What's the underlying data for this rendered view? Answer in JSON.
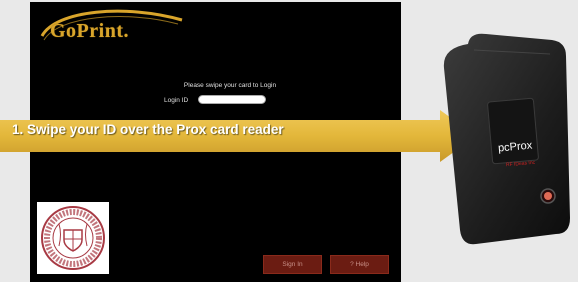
{
  "logo": {
    "text": "GoPrint."
  },
  "login": {
    "prompt": "Please swipe your card to Login",
    "label": "Login ID",
    "value": ""
  },
  "buttons": {
    "sign_in": "Sign In",
    "help": "? Help"
  },
  "banner": {
    "text": "1. Swipe your ID over the Prox card reader"
  },
  "reader": {
    "brand": "pcProx",
    "sub": "RF IDeas Inc"
  },
  "colors": {
    "banner": "#e3b73a",
    "logo": "#d9a52b",
    "button": "#6b1c12",
    "seal": "#a83a44"
  }
}
